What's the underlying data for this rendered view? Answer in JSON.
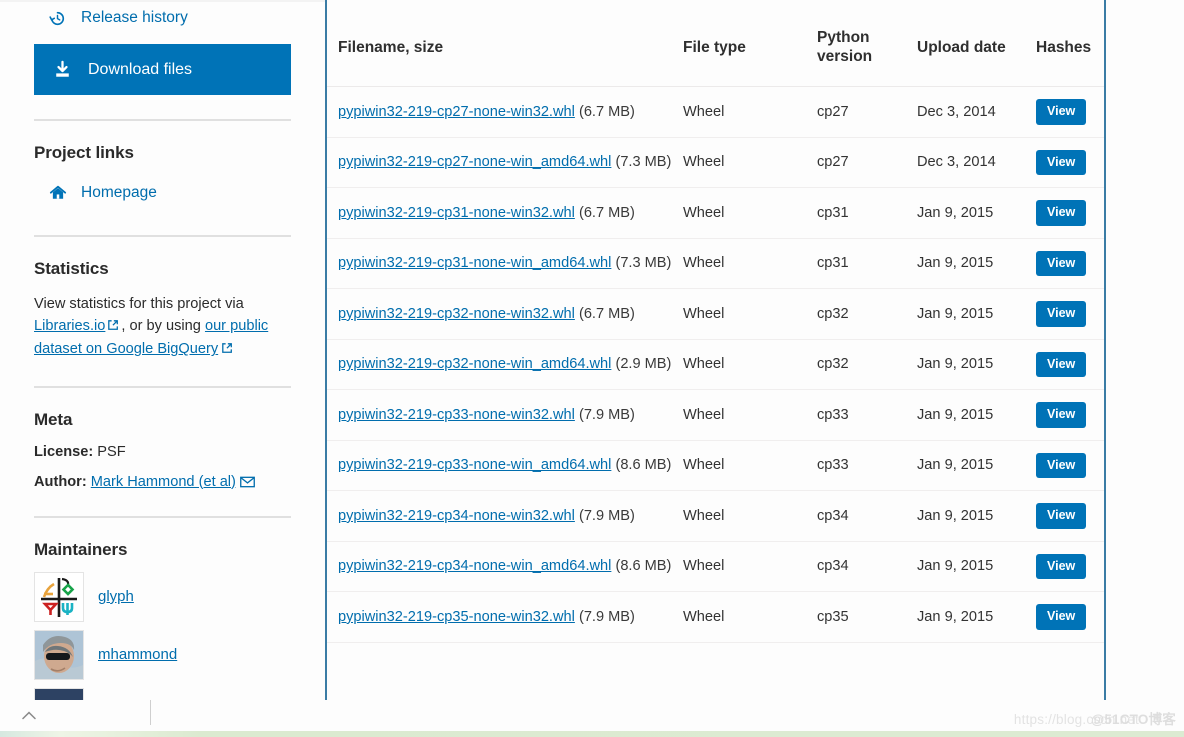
{
  "sidebar": {
    "nav": [
      {
        "label": "Release history",
        "icon": "history-icon",
        "active": false
      },
      {
        "label": "Download files",
        "icon": "download-icon",
        "active": true
      }
    ],
    "project_links": {
      "heading": "Project links",
      "items": [
        {
          "label": "Homepage",
          "icon": "home-icon"
        }
      ]
    },
    "statistics": {
      "heading": "Statistics",
      "text_1": "View statistics for this project via ",
      "link_1": "Libraries.io",
      "text_2": ", or by using ",
      "link_2": "our public dataset on Google BigQuery",
      "external_icon": "external-link-icon"
    },
    "meta": {
      "heading": "Meta",
      "license_label": "License:",
      "license_value": "PSF",
      "author_label": "Author:",
      "author_value": "Mark Hammond (et al)",
      "email_icon": "envelope-icon"
    },
    "maintainers": {
      "heading": "Maintainers",
      "items": [
        {
          "name": "glyph",
          "avatar": "glyph-logo-avatar"
        },
        {
          "name": "mhammond",
          "avatar": "photo-avatar"
        },
        {
          "name": "",
          "avatar": "partial-avatar"
        }
      ]
    }
  },
  "table": {
    "headers": {
      "filename": "Filename, size",
      "filetype": "File type",
      "pyversion": "Python version",
      "uploaddate": "Upload date",
      "hashes": "Hashes"
    },
    "view_label": "View",
    "rows": [
      {
        "filename": "pypiwin32-219-cp27-none-win32.whl",
        "size": "(6.7 MB)",
        "filetype": "Wheel",
        "pyversion": "cp27",
        "date": "Dec 3, 2014"
      },
      {
        "filename": "pypiwin32-219-cp27-none-win_amd64.whl",
        "size": "(7.3 MB)",
        "filetype": "Wheel",
        "pyversion": "cp27",
        "date": "Dec 3, 2014"
      },
      {
        "filename": "pypiwin32-219-cp31-none-win32.whl",
        "size": "(6.7 MB)",
        "filetype": "Wheel",
        "pyversion": "cp31",
        "date": "Jan 9, 2015"
      },
      {
        "filename": "pypiwin32-219-cp31-none-win_amd64.whl",
        "size": "(7.3 MB)",
        "filetype": "Wheel",
        "pyversion": "cp31",
        "date": "Jan 9, 2015"
      },
      {
        "filename": "pypiwin32-219-cp32-none-win32.whl",
        "size": "(6.7 MB)",
        "filetype": "Wheel",
        "pyversion": "cp32",
        "date": "Jan 9, 2015"
      },
      {
        "filename": "pypiwin32-219-cp32-none-win_amd64.whl",
        "size": "(2.9 MB)",
        "filetype": "Wheel",
        "pyversion": "cp32",
        "date": "Jan 9, 2015"
      },
      {
        "filename": "pypiwin32-219-cp33-none-win32.whl",
        "size": "(7.9 MB)",
        "filetype": "Wheel",
        "pyversion": "cp33",
        "date": "Jan 9, 2015"
      },
      {
        "filename": "pypiwin32-219-cp33-none-win_amd64.whl",
        "size": "(8.6 MB)",
        "filetype": "Wheel",
        "pyversion": "cp33",
        "date": "Jan 9, 2015"
      },
      {
        "filename": "pypiwin32-219-cp34-none-win32.whl",
        "size": "(7.9 MB)",
        "filetype": "Wheel",
        "pyversion": "cp34",
        "date": "Jan 9, 2015"
      },
      {
        "filename": "pypiwin32-219-cp34-none-win_amd64.whl",
        "size": "(8.6 MB)",
        "filetype": "Wheel",
        "pyversion": "cp34",
        "date": "Jan 9, 2015"
      },
      {
        "filename": "pypiwin32-219-cp35-none-win32.whl",
        "size": "(7.9 MB)",
        "filetype": "Wheel",
        "pyversion": "cp35",
        "date": "Jan 9, 2015"
      }
    ]
  },
  "bottom": {
    "scroll_top_icon": "chevron-up-icon",
    "watermark_url": "https://blog.csdn.net",
    "watermark_tag": "@51CTO博客"
  },
  "colors": {
    "accent": "#0073b7",
    "link": "#006dad",
    "border": "#3a7ca5"
  }
}
